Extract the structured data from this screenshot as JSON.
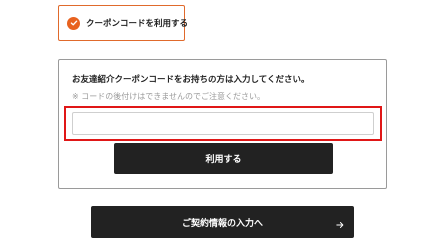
{
  "coupon_toggle": {
    "label": "クーポンコードを利用する",
    "checked": true,
    "icon": "check-circle-icon",
    "accent_color": "#e8621f"
  },
  "coupon_panel": {
    "title": "お友達紹介クーポンコードをお持ちの方は入力してください。",
    "note": "※ コードの後付けはできませんのでご注意ください。",
    "input": {
      "value": "",
      "highlight_color": "#e01717"
    },
    "apply_button_label": "利用する"
  },
  "next_button": {
    "label": "ご契約情報の入力へ",
    "icon": "arrow-right-icon"
  }
}
